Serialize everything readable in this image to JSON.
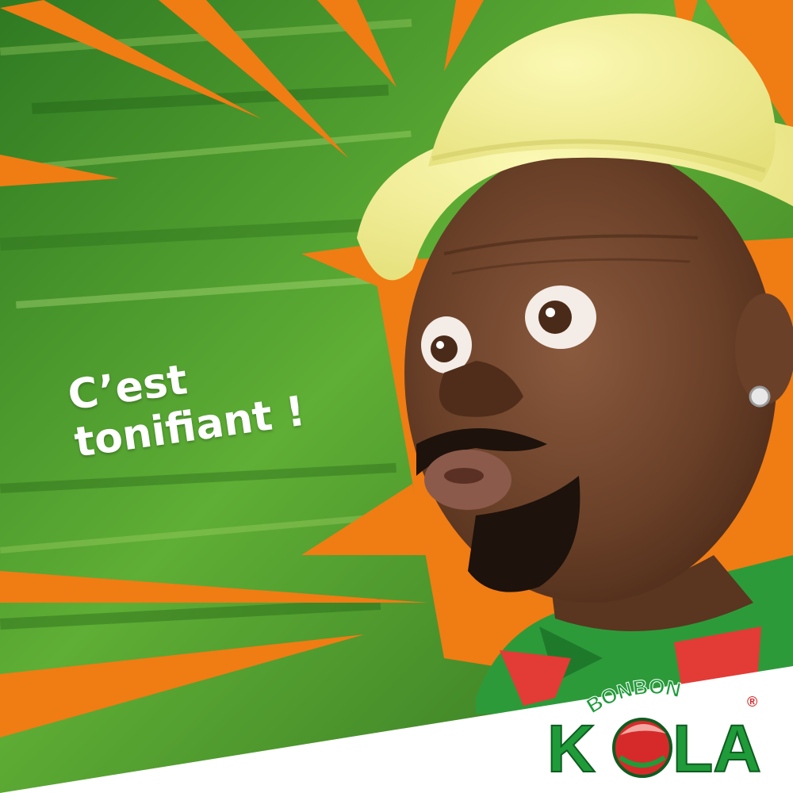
{
  "ad": {
    "tagline_line1": "C’est",
    "tagline_line2": "tonifiant !"
  },
  "logo": {
    "brand_top": "BONBON",
    "brand_left": "K",
    "brand_right": "LA",
    "registered_mark": "®"
  },
  "colors": {
    "green_bg": "#4f9a2c",
    "orange_burst": "#f07c14",
    "hat_yellow": "#f3ef8f",
    "brand_green": "#1f9b3a",
    "brand_red": "#d62a2a",
    "footer_white": "#ffffff"
  }
}
